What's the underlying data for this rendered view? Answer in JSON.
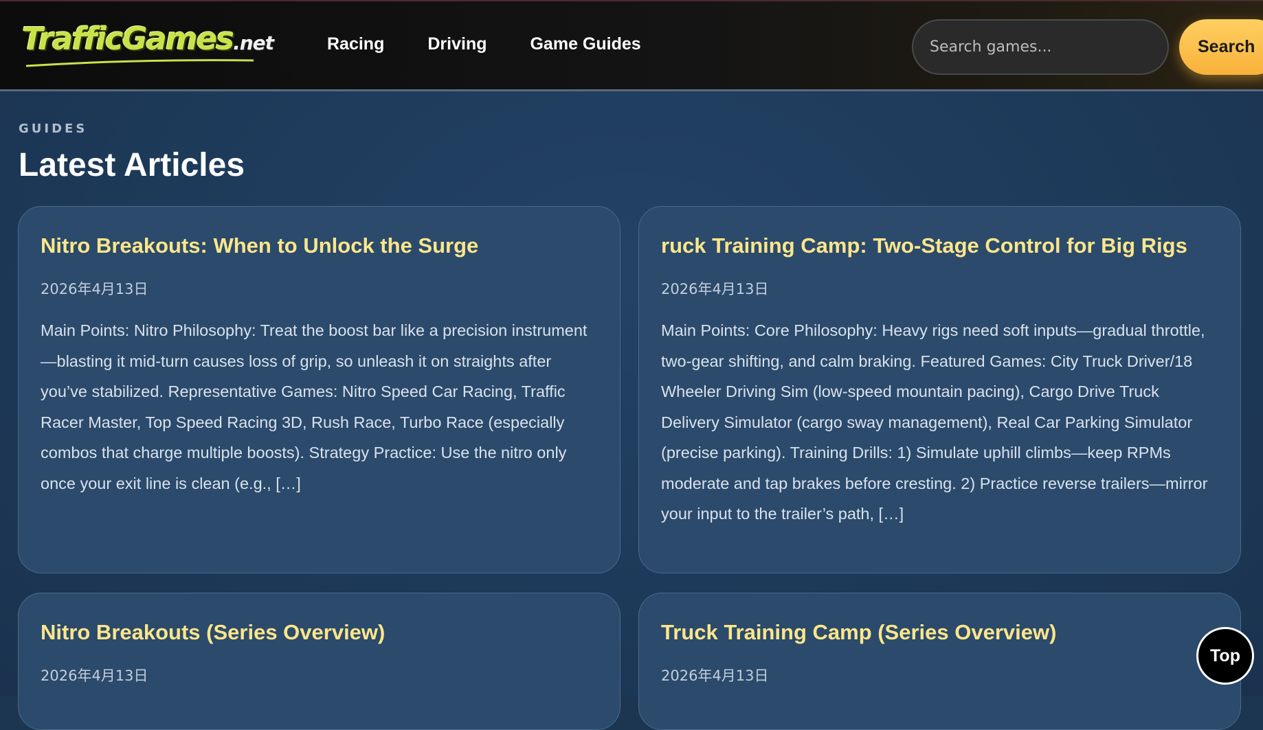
{
  "header": {
    "logo": {
      "main": "TrafficGames",
      "suffix": ".net"
    },
    "nav": [
      {
        "label": "Racing"
      },
      {
        "label": "Driving"
      },
      {
        "label": "Game Guides"
      }
    ],
    "search": {
      "placeholder": "Search games...",
      "button_label": "Search"
    }
  },
  "main": {
    "eyebrow": "GUIDES",
    "title": "Latest Articles",
    "articles": [
      {
        "title": "Nitro Breakouts: When to Unlock the Surge",
        "date": "2026年4月13日",
        "excerpt": "Main Points: Nitro Philosophy: Treat the boost bar like a precision instrument—blasting it mid-turn causes loss of grip, so unleash it on straights after you’ve stabilized. Representative Games: Nitro Speed Car Racing, Traffic Racer Master, Top Speed Racing 3D, Rush Race, Turbo Race (especially combos that charge multiple boosts). Strategy Practice: Use the nitro only once your exit line is clean (e.g., […]"
      },
      {
        "title": "ruck Training Camp: Two-Stage Control for Big Rigs",
        "date": "2026年4月13日",
        "excerpt": "Main Points: Core Philosophy: Heavy rigs need soft inputs—gradual throttle, two-gear shifting, and calm braking. Featured Games: City Truck Driver/18 Wheeler Driving Sim (low-speed mountain pacing), Cargo Drive Truck Delivery Simulator (cargo sway management), Real Car Parking Simulator (precise parking). Training Drills: 1) Simulate uphill climbs—keep RPMs moderate and tap brakes before cresting. 2) Practice reverse trailers—mirror your input to the trailer’s path, […]"
      },
      {
        "title": "Nitro Breakouts (Series Overview)",
        "date": "2026年4月13日",
        "excerpt": ""
      },
      {
        "title": "Truck Training Camp (Series Overview)",
        "date": "2026年4月13日",
        "excerpt": ""
      }
    ]
  },
  "top_button": {
    "label": "Top"
  }
}
